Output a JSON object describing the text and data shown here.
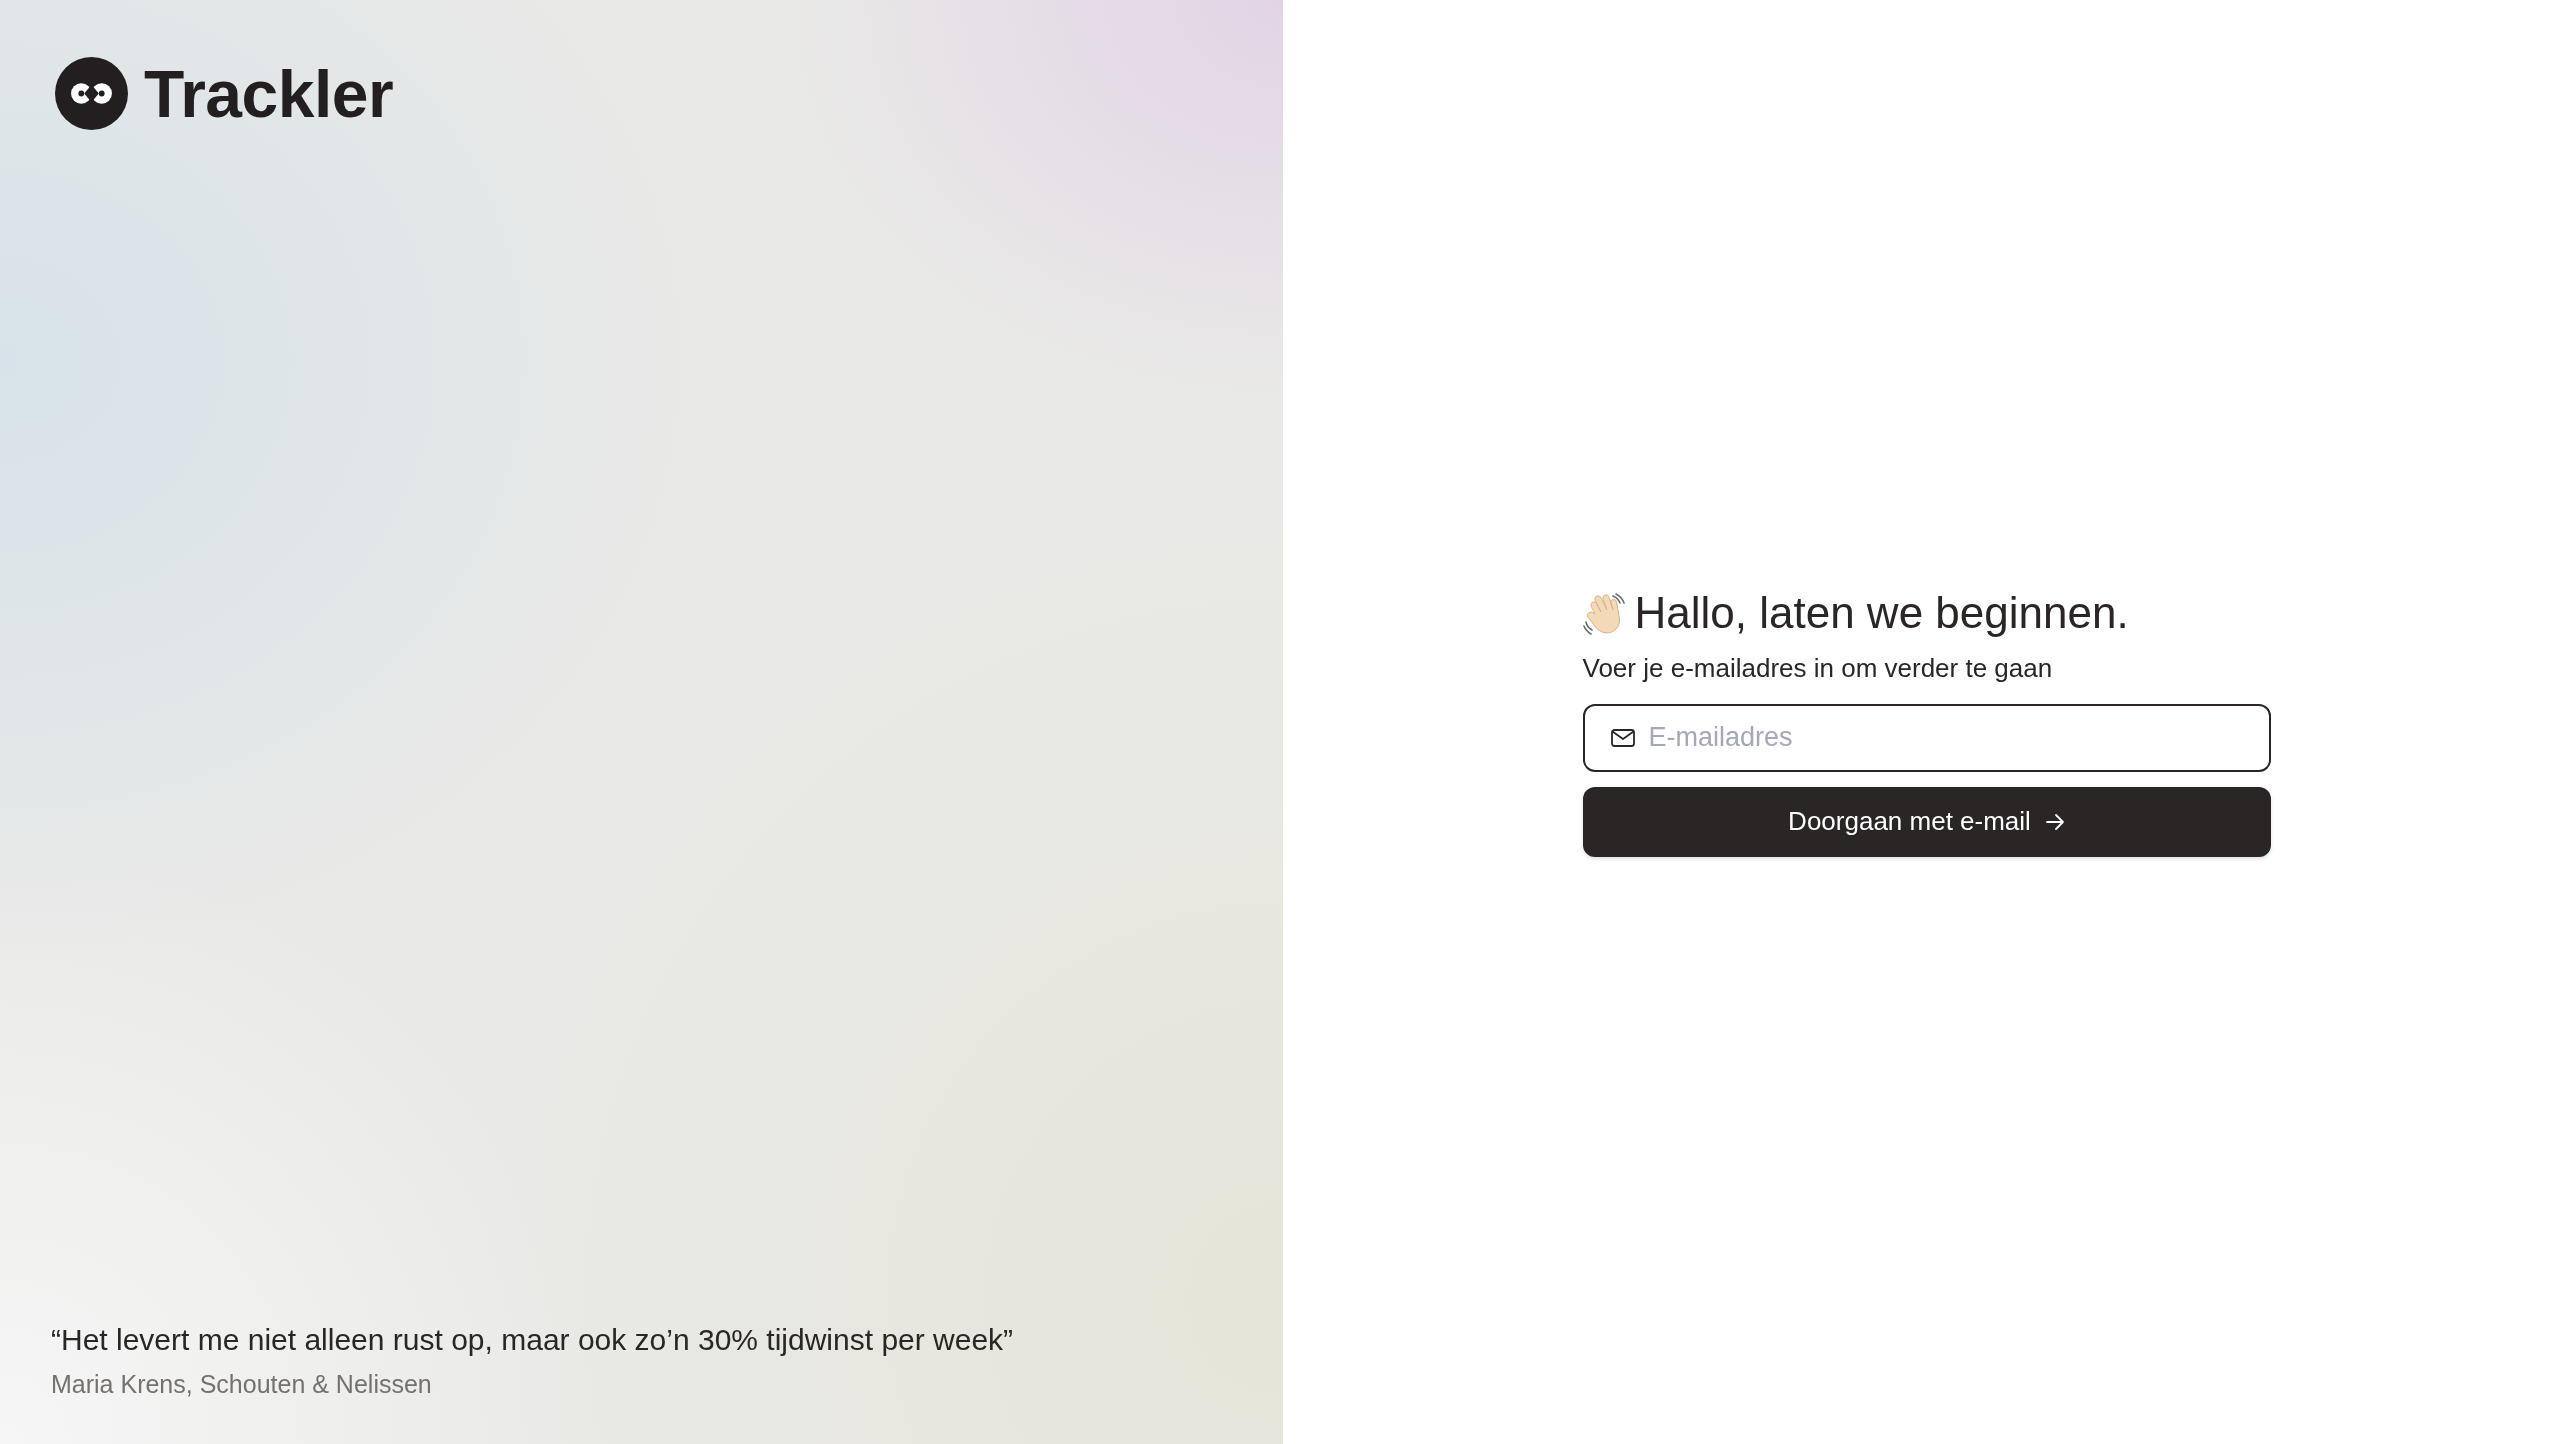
{
  "brand": {
    "name": "Trackler"
  },
  "testimonial": {
    "quote": "“Het levert me niet alleen rust op, maar ook zo’n 30% tijdwinst per week”",
    "author": "Maria Krens, Schouten & Nelissen"
  },
  "login": {
    "heading": "Hallo, laten we beginnen.",
    "subtitle": "Voer je e-mailadres in om verder te gaan",
    "email_field": {
      "placeholder": "E-mailadres"
    },
    "submit_button": {
      "label": "Doorgaan met e-mail"
    }
  }
}
